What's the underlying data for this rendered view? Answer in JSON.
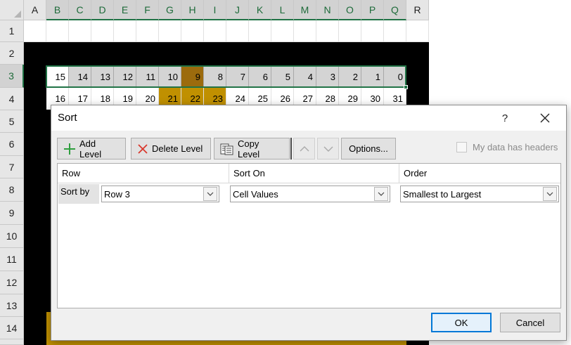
{
  "sheet": {
    "corner_label": "",
    "columns": [
      "A",
      "B",
      "C",
      "D",
      "E",
      "F",
      "G",
      "H",
      "I",
      "J",
      "K",
      "L",
      "M",
      "N",
      "O",
      "P",
      "Q",
      "R"
    ],
    "rows": [
      "1",
      "2",
      "3",
      "4",
      "5",
      "6",
      "7",
      "8",
      "9",
      "10",
      "11",
      "12",
      "13",
      "14"
    ],
    "row3_values": [
      "15",
      "14",
      "13",
      "12",
      "11",
      "10",
      "9",
      "8",
      "7",
      "6",
      "5",
      "4",
      "3",
      "2",
      "1",
      "0"
    ],
    "row4_values": [
      "16",
      "17",
      "18",
      "19",
      "20",
      "21",
      "22",
      "23",
      "24",
      "25",
      "26",
      "27",
      "28",
      "29",
      "30",
      "31"
    ]
  },
  "dialog": {
    "title": "Sort",
    "help_label": "?",
    "toolbar": {
      "add_level": "Add Level",
      "delete_level": "Delete Level",
      "copy_level": "Copy Level",
      "options": "Options..."
    },
    "headers_checkbox_label": "My data has headers",
    "headers_checked": false,
    "columns": {
      "row": "Row",
      "sort_on": "Sort On",
      "order": "Order"
    },
    "level": {
      "label": "Sort by",
      "row_value": "Row 3",
      "sort_on_value": "Cell Values",
      "order_value": "Smallest to Largest"
    },
    "ok_label": "OK",
    "cancel_label": "Cancel"
  },
  "colors": {
    "accent_green": "#217346",
    "gold": "#c09000",
    "dark_gold": "#9c6b0d",
    "focus_blue": "#0078d7",
    "add_icon": "#2e9e3e",
    "delete_icon": "#d9382d"
  },
  "icons": [
    "add-icon",
    "delete-icon",
    "copy-icon",
    "move-up-icon",
    "move-down-icon",
    "close-icon",
    "dropdown-icon"
  ]
}
